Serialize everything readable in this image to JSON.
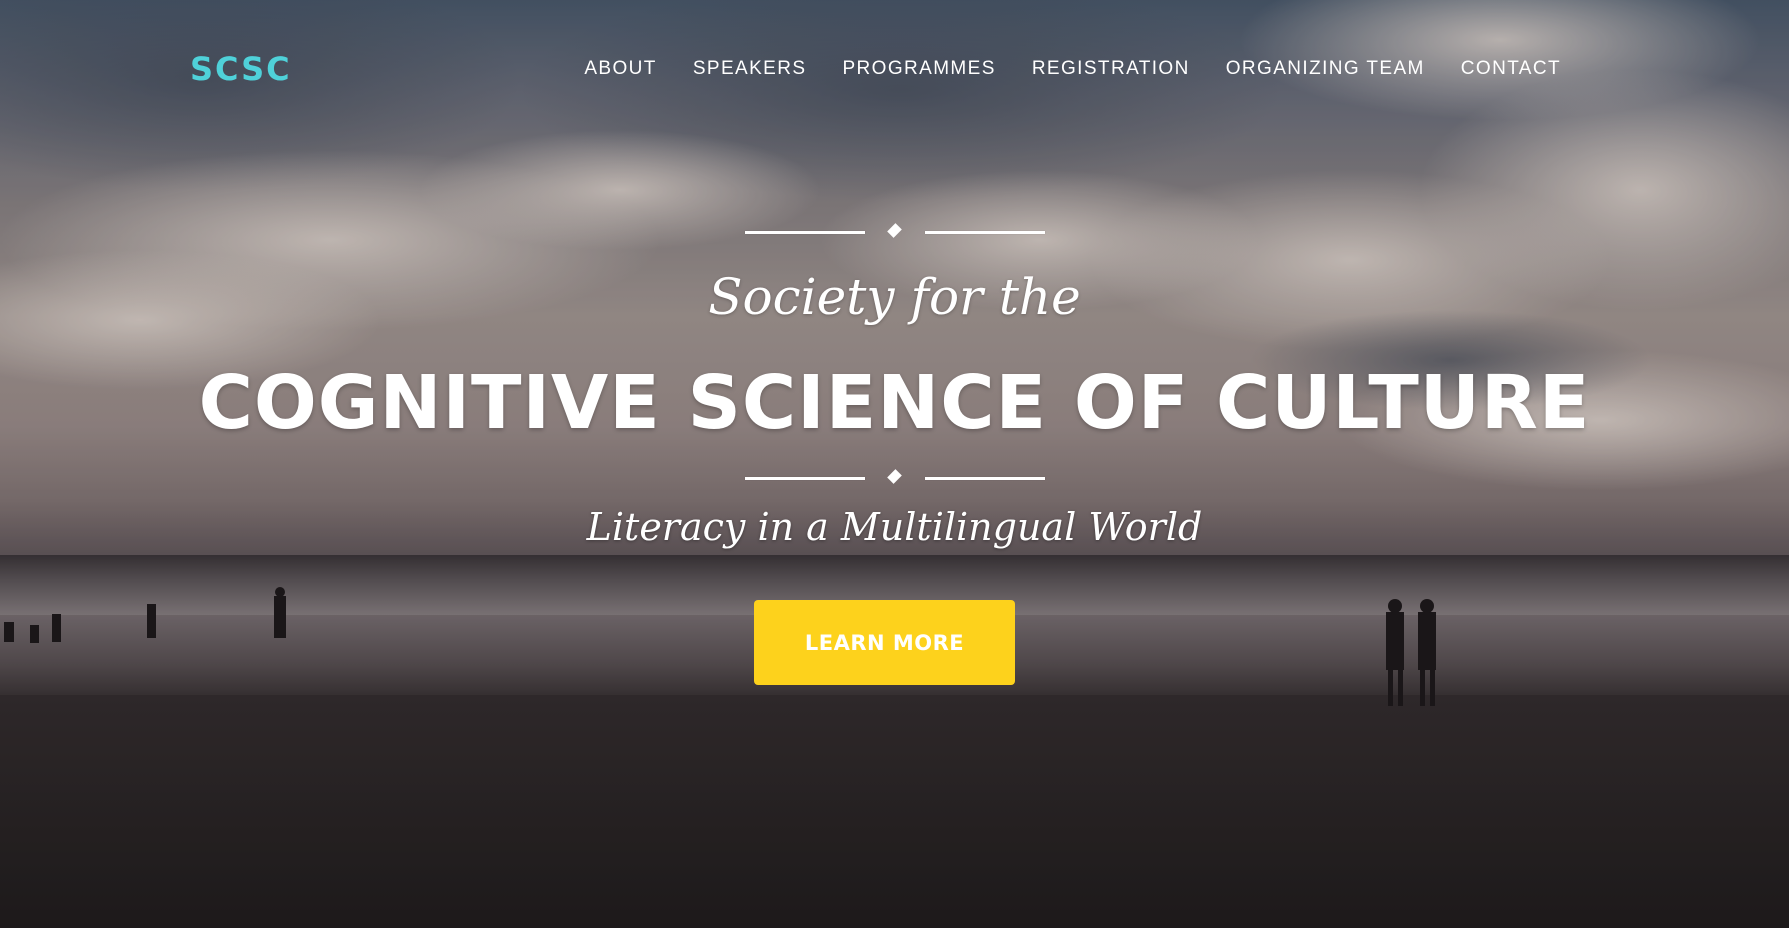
{
  "navbar": {
    "brand": "SCSC",
    "links": [
      {
        "label": "ABOUT"
      },
      {
        "label": "SPEAKERS"
      },
      {
        "label": "PROGRAMMES"
      },
      {
        "label": "REGISTRATION"
      },
      {
        "label": "ORGANIZING TEAM"
      },
      {
        "label": "CONTACT"
      }
    ]
  },
  "masthead": {
    "subtitle": "Society for the",
    "title": "COGNITIVE SCIENCE OF CULTURE",
    "tagline": "Literacy in a Multilingual World",
    "cta_label": "LEARN MORE"
  },
  "colors": {
    "brand": "#4fd1d9",
    "cta_background": "#fdd21c",
    "text": "#ffffff"
  }
}
